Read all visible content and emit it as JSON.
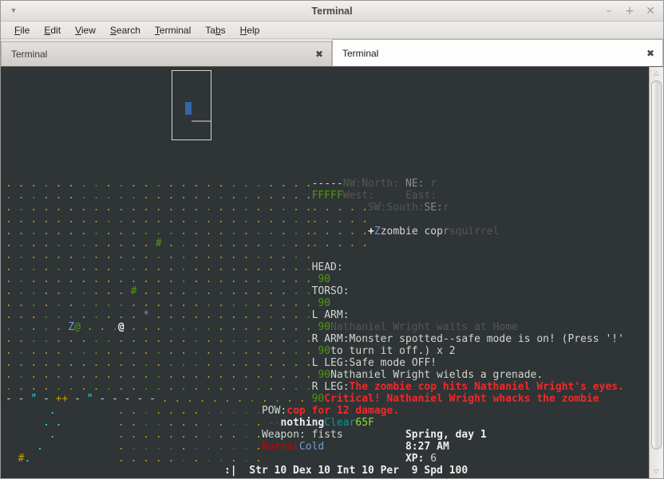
{
  "window": {
    "title": "Terminal",
    "menu_arrow_icon": "chevron-down-icon",
    "minimize_label": "–",
    "maximize_label": "+",
    "close_label": "✕"
  },
  "menubar": {
    "items": [
      {
        "pre": "",
        "mnemonic": "F",
        "post": "ile"
      },
      {
        "pre": "",
        "mnemonic": "E",
        "post": "dit"
      },
      {
        "pre": "",
        "mnemonic": "V",
        "post": "iew"
      },
      {
        "pre": "",
        "mnemonic": "S",
        "post": "earch"
      },
      {
        "pre": "",
        "mnemonic": "T",
        "post": "erminal"
      },
      {
        "pre": "Ta",
        "mnemonic": "b",
        "post": "s"
      },
      {
        "pre": "",
        "mnemonic": "H",
        "post": "elp"
      }
    ]
  },
  "tabs": [
    {
      "label": "Terminal",
      "active": false,
      "close_label": "✖"
    },
    {
      "label": "Terminal",
      "active": true,
      "close_label": "✖"
    }
  ],
  "scrollbar": {
    "up_icon": "△",
    "down_icon": "▽"
  },
  "terminal": {
    "map": {
      "rows": [
        ". . . . . . . . . . . . . . . . . . . . . . . . .",
        ". . . . . . . . . . . . . . . . . . . . . . . . .",
        ". . . . . . . . . . . . . . . . . . . . . . . . .",
        ". . . . . . . . . . . . . . . . . . . . . . . . .",
        ". . . . . . . . . . . . . . . . . . . . . . . . .",
        ". . . . . . . . . . . . # . . . . . . . . . . . .",
        ". . . . . . . . . . . . . . . . . . . . . . . . .",
        ". . . . . . . . . . . . . . . . . . . . . . . . .",
        ". . . . . . . . . . . . . . . . . . . . . . . . .",
        ". . . . . . . . . . # . . . . . . . . . . . . . .",
        ". . . . . . . . . . . . . . . . . . . . . . . . .",
        ". . . . . . . . . . . * . . . . . . . . . . . . .",
        ". . . . . Z@ . . .@ . . . . . . . . . . . . . . .",
        ". . . . . . . . . . . . . . . . . . . . . . . . .",
        ". . . . . . . . . . . . . . . . . . . . . . . . .",
        ". . . . . . . . . . . . . . . . . . . . . . . . .",
        ". . . . . . . . . . . . . . . . . . . . . . . . .",
        ". . . . . . . . . . . . . . . . . . . . . . . . .",
        "- - \" - ++ - \" - - - - - . . . . . . . . . . . .",
        "       .          . . . . . . . . . . . .",
        "      . .         . . . . . . . . . . . .",
        "       .          . . . . . . . . . . . .",
        "     .            . . . . . . . . . . . .",
        "  #.              . . . . . . . . . . . ."
      ]
    },
    "minimap": {
      "header": "FFFFF",
      "dot_rows": [
        ". . . . .",
        ". . . . .",
        ". . . . .",
        ". . . . ."
      ],
      "center_marker": "+",
      "cursor_icon": "minimap-cursor"
    },
    "compass": {
      "nw_label": "NW:",
      "nw_value": "",
      "north_label": "North:",
      "north_value": "",
      "ne_label": "NE:",
      "ne_value": "r",
      "west_label": "West:",
      "west_value": "",
      "east_label": "East:",
      "east_value": "",
      "sw_label": "SW:",
      "sw_value": "",
      "south_label": "South:",
      "south_value": "",
      "se_label": "SE:",
      "se_value": "r"
    },
    "monsters": [
      {
        "glyph": "Z",
        "name": "zombie cop"
      },
      {
        "glyph": "r",
        "name": "squirrel"
      }
    ],
    "body_parts": [
      {
        "label": "HEAD:",
        "value": "90"
      },
      {
        "label": "TORSO:",
        "value": "90"
      },
      {
        "label": "L ARM:",
        "value": "90"
      },
      {
        "label": "R ARM:",
        "value": "90"
      },
      {
        "label": "L LEG:",
        "value": "90"
      },
      {
        "label": "R LEG:",
        "value": "90"
      },
      {
        "label": "POW:",
        "value": "--"
      }
    ],
    "messages": [
      {
        "text": "Nathaniel Wright waits at Home",
        "style": "old"
      },
      {
        "text": "Monster spotted--safe mode is on! (Press '!'",
        "style": "normal"
      },
      {
        "text": "to turn it off.) x 2",
        "style": "normal"
      },
      {
        "text": "Safe mode OFF!",
        "style": "normal"
      },
      {
        "text": "Nathaniel Wright wields a grenade.",
        "style": "normal"
      },
      {
        "text": "The zombie cop hits Nathaniel Wright's eyes.",
        "style": "bad"
      },
      {
        "text": "Critical! Nathaniel Wright whacks the zombie",
        "style": "bad"
      },
      {
        "text": "cop for 12 damage.",
        "style": "bad"
      }
    ],
    "status": {
      "armor_label": "nothing",
      "weather_label": "Clear",
      "temperature": "65F",
      "weapon_label": "Weapon:",
      "weapon_value": "fists",
      "morale_label": "Normal",
      "temp_feel": "Cold",
      "date": "Spring, day 1",
      "time": "8:27 AM",
      "xp_label": "XP:",
      "xp_value": "6",
      "face": ":|",
      "stats": "Str 10 Dex 10 Int 10 Per  9 Spd 100"
    }
  }
}
